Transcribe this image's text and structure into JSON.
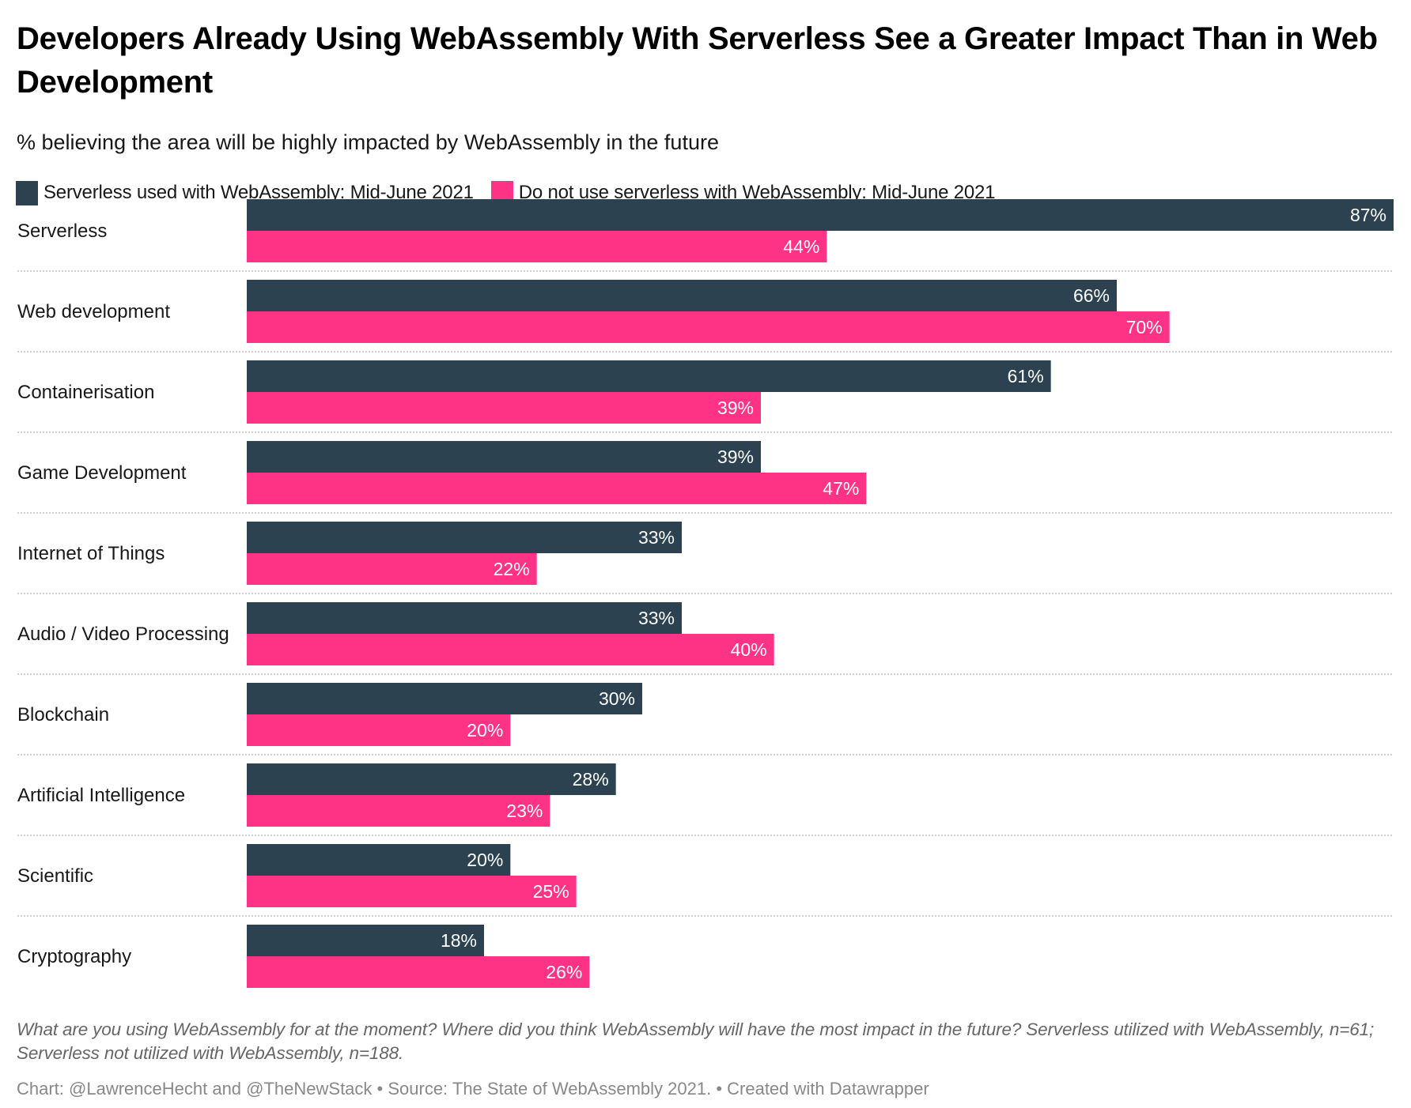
{
  "header": {
    "title": "Developers Already Using WebAssembly With Serverless See a Greater Impact Than in Web Development",
    "subtitle": "% believing the area will be highly impacted by WebAssembly in the future"
  },
  "legend": [
    {
      "label": "Serverless used with WebAssembly: Mid-June 2021",
      "color": "#2c4251"
    },
    {
      "label": "Do not use serverless with WebAssembly: Mid-June 2021",
      "color": "#ff3386"
    }
  ],
  "footer": {
    "note": "What are you using WebAssembly for at the moment? Where did you think WebAssembly will have the most impact in the future? Serverless utilized with WebAssembly, n=61; Serverless not utilized with WebAssembly, n=188.",
    "credit": "Chart: @LawrenceHecht and @TheNewStack • Source: The State of WebAssembly 2021. • Created with Datawrapper"
  },
  "chart_data": {
    "type": "bar",
    "orientation": "horizontal",
    "title": "Developers Already Using WebAssembly With Serverless See a Greater Impact Than in Web Development",
    "subtitle": "% believing the area will be highly impacted by WebAssembly in the future",
    "xlabel": "",
    "ylabel": "",
    "value_suffix": "%",
    "xlim": [
      0,
      87
    ],
    "grid": false,
    "legend_position": "top-left",
    "categories": [
      "Serverless",
      "Web development",
      "Containerisation",
      "Game Development",
      "Internet of Things",
      "Audio / Video Processing",
      "Blockchain",
      "Artificial Intelligence",
      "Scientific",
      "Cryptography"
    ],
    "series": [
      {
        "name": "Serverless used with WebAssembly: Mid-June 2021",
        "color": "#2c4251",
        "values": [
          87,
          66,
          61,
          39,
          33,
          33,
          30,
          28,
          20,
          18
        ]
      },
      {
        "name": "Do not use serverless with WebAssembly: Mid-June 2021",
        "color": "#ff3386",
        "values": [
          44,
          70,
          39,
          47,
          22,
          40,
          20,
          23,
          25,
          26
        ]
      }
    ]
  }
}
